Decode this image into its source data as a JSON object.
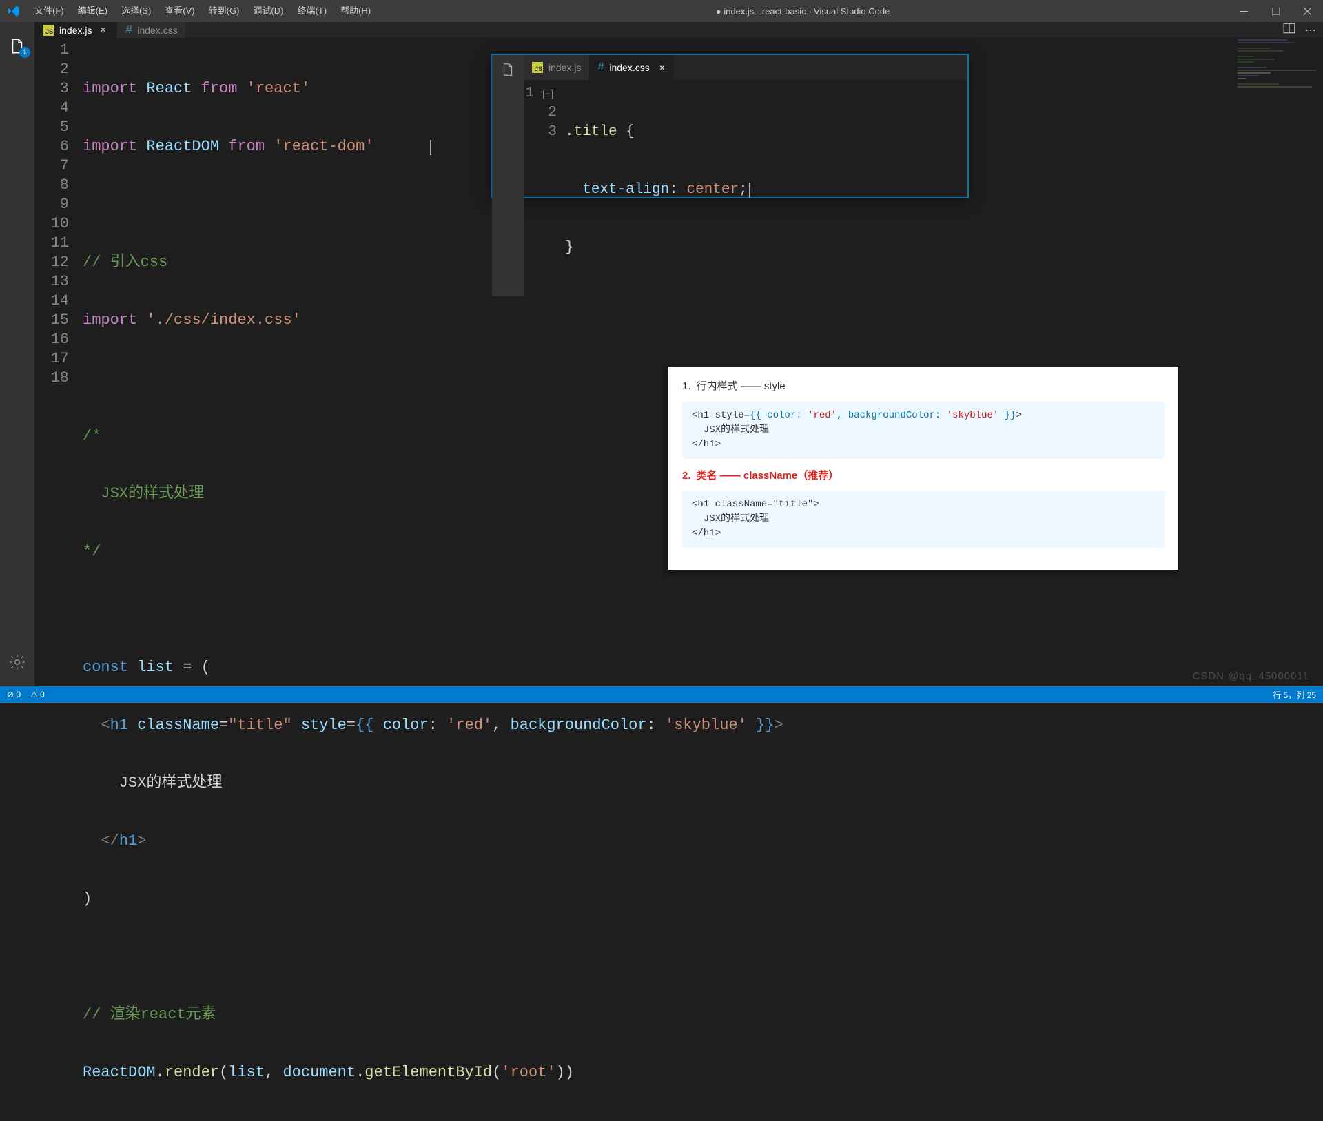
{
  "window": {
    "title": "● index.js - react-basic - Visual Studio Code",
    "menus": [
      "文件(F)",
      "编辑(E)",
      "选择(S)",
      "查看(V)",
      "转到(G)",
      "调试(D)",
      "终端(T)",
      "帮助(H)"
    ]
  },
  "activity": {
    "explorer_badge": "1"
  },
  "tabs": [
    {
      "name": "index.js",
      "type": "js",
      "active": true,
      "dirty": false
    },
    {
      "name": "index.css",
      "type": "css",
      "active": false,
      "dirty": false
    }
  ],
  "editor": {
    "line_numbers": [
      "1",
      "2",
      "3",
      "4",
      "5",
      "6",
      "7",
      "8",
      "9",
      "10",
      "11",
      "12",
      "13",
      "14",
      "15",
      "16",
      "17",
      "18"
    ],
    "code": {
      "l1": {
        "a": "import",
        "b": "React",
        "c": "from",
        "d": "'react'"
      },
      "l2": {
        "a": "import",
        "b": "ReactDOM",
        "c": "from",
        "d": "'react-dom'"
      },
      "l4": "// 引入css",
      "l5": {
        "a": "import",
        "b": "'./css/index.css'"
      },
      "l7": "/*",
      "l8": "  JSX的样式处理",
      "l9": "*/",
      "l11": {
        "a": "const",
        "b": "list",
        "c": "= ("
      },
      "l12": {
        "open": "  <",
        "tag": "h1",
        "an": "className",
        "av": "\"title\"",
        "sn": "style",
        "inner": "{{ ",
        "p1": "color",
        "pv1": "'red'",
        "p2": "backgroundColor",
        "pv2": "'skyblue'",
        "end": " }}",
        "close": ">"
      },
      "l13": "    JSX的样式处理",
      "l14": {
        "open": "  </",
        "tag": "h1",
        "close": ">"
      },
      "l15": ")",
      "l17": "// 渲染react元素",
      "l18": {
        "a": "ReactDOM",
        "b": ".",
        "c": "render",
        "d": "(",
        "e": "list",
        "f": ", ",
        "g": "document",
        "h": ".",
        "i": "getElementById",
        "j": "(",
        "k": "'root'",
        "l": "))"
      }
    }
  },
  "inset": {
    "menus": [
      "文件(F)",
      "编辑(E)",
      "选择(S)",
      "查看(V)",
      "转到(G)",
      "调试(D)",
      "终端(T)",
      "帮助(H)"
    ],
    "tabs": [
      {
        "name": "index.js",
        "type": "js",
        "active": false
      },
      {
        "name": "index.css",
        "type": "css",
        "active": true
      }
    ],
    "line_numbers": [
      "1",
      "2",
      "3"
    ],
    "css": {
      "selector": ".title",
      "prop": "text-align",
      "val": "center"
    }
  },
  "note": {
    "bullet1_num": "1.",
    "bullet1": "行内样式 —— style",
    "code1": "<h1 style={{ color: 'red', backgroundColor: 'skyblue' }}>\n  JSX的样式处理\n</h1>",
    "bullet2_num": "2.",
    "bullet2": "类名 —— className（推荐）",
    "code2": "<h1 className=\"title\">\n  JSX的样式处理\n</h1>"
  },
  "status": {
    "errors": "0",
    "warnings": "0",
    "right": "行 5，列 25"
  },
  "watermark": "CSDN @qq_45000011"
}
